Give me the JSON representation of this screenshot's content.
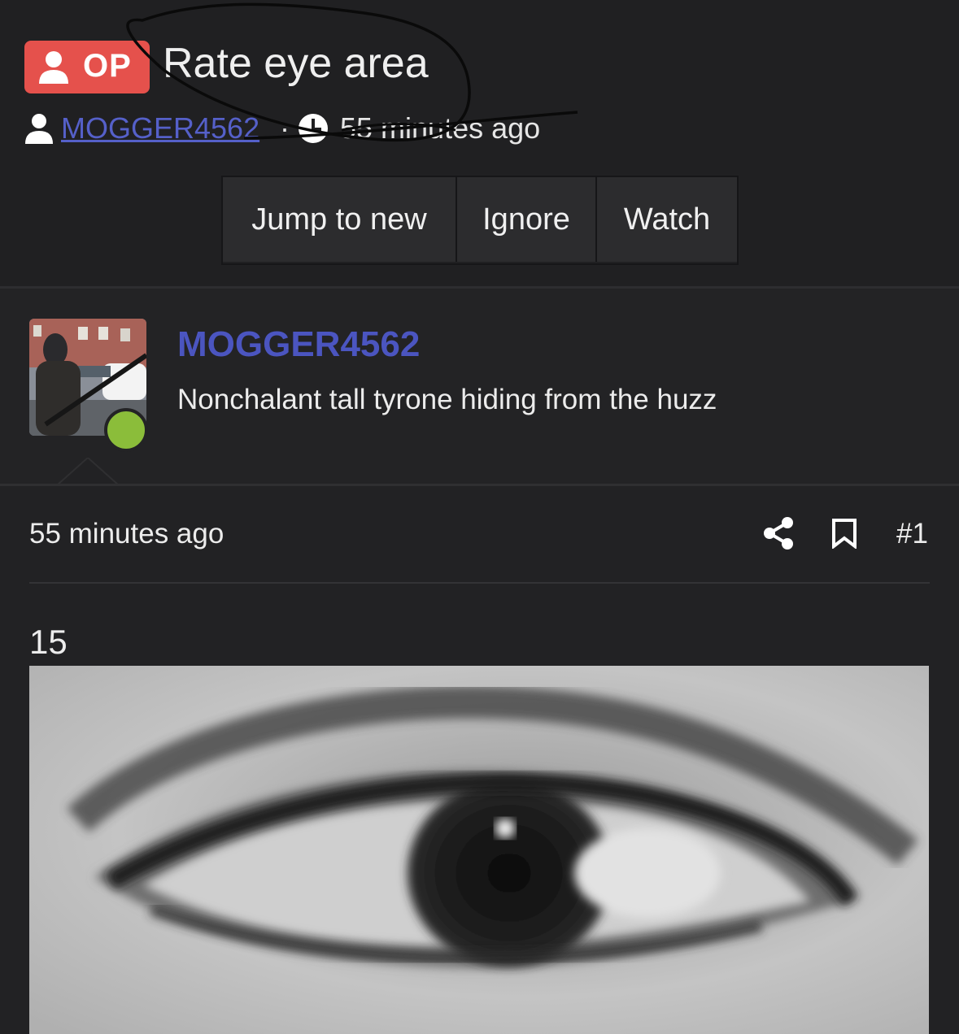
{
  "thread": {
    "op_badge": "OP",
    "title": "Rate eye area",
    "author": "MOGGER4562",
    "separator": "·",
    "time": "55 minutes ago"
  },
  "actions": [
    "Jump to new",
    "Ignore",
    "Watch"
  ],
  "post": {
    "username": "MOGGER4562",
    "user_title": "Nonchalant tall tyrone hiding from the huzz",
    "time": "55 minutes ago",
    "post_number": "#1",
    "body": "15",
    "online_color": "#8bbd3a"
  },
  "icons": [
    "user-icon",
    "clock-icon",
    "share-icon",
    "bookmark-icon"
  ],
  "colors": {
    "op_badge": "#e5514c",
    "link": "#4b55c0",
    "background": "#222224"
  }
}
